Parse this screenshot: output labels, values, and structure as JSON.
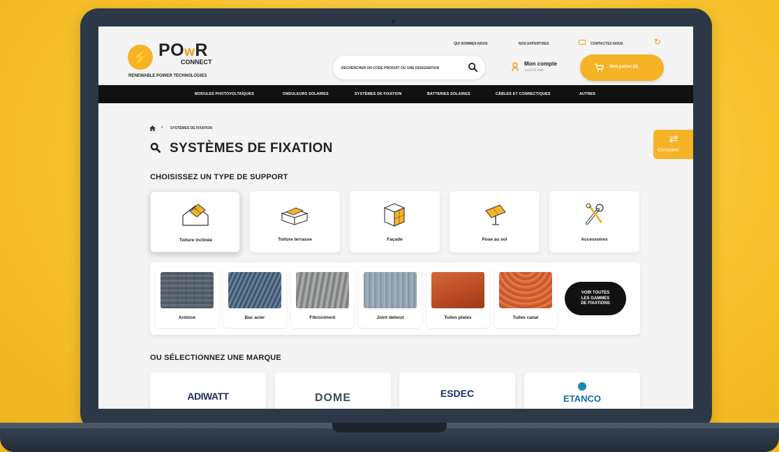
{
  "header": {
    "logo_name_pre": "PO",
    "logo_name_w": "w",
    "logo_name_post": "R",
    "logo_connect": "CONNECT",
    "logo_tagline": "RENEWABLE POWER TECHNOLOGIES",
    "top_links": [
      "QUI SOMMES-NOUS",
      "NOS EXPERTISES",
      "CONTACTEZ-NOUS"
    ],
    "search_placeholder": "RECHERCHER UN CODE PRODUIT OU UNE DESIGNATION",
    "account_label": "Mon compte",
    "account_user": "test103 web",
    "cart_label": "Mon panier (0)"
  },
  "nav": {
    "items": [
      "MODULES PHOTOVOLTAÏQUES",
      "ONDULEURS SOLAIRES",
      "SYSTÈMES DE FIXATION",
      "BATTERIES SOLAIRES",
      "CÂBLES ET CONNECTIQUES",
      "AUTRES"
    ]
  },
  "breadcrumb": {
    "current": "SYSTÈMES DE FIXATION"
  },
  "page_title": "SYSTÈMES DE FIXATION",
  "compare_label": "Comparer",
  "support_section": {
    "title": "CHOISISSEZ UN TYPE DE SUPPORT",
    "items": [
      {
        "label": "Toiture inclinée",
        "icon": "inclined-roof-icon"
      },
      {
        "label": "Toiture terrasse",
        "icon": "flat-roof-icon"
      },
      {
        "label": "Façade",
        "icon": "facade-icon"
      },
      {
        "label": "Pose au sol",
        "icon": "ground-mount-icon"
      },
      {
        "label": "Accessoires",
        "icon": "wrench-icon"
      }
    ]
  },
  "roof_types": {
    "items": [
      "Ardoise",
      "Bac acier",
      "Fibrociment",
      "Joint debout",
      "Tuiles plates",
      "Tuiles canal"
    ],
    "see_all_line1": "VOIR TOUTES",
    "see_all_line2": "LES GAMMES",
    "see_all_line3": "DE FIXATIONS"
  },
  "brand_section": {
    "title": "OU SÉLECTIONNEZ UNE MARQUE",
    "brands": [
      "ADIWATT",
      "DOME",
      "ESDEC",
      "ETANCO"
    ]
  },
  "colors": {
    "accent": "#f6b326",
    "nav_bg": "#111111",
    "background": "#f6c22d"
  }
}
